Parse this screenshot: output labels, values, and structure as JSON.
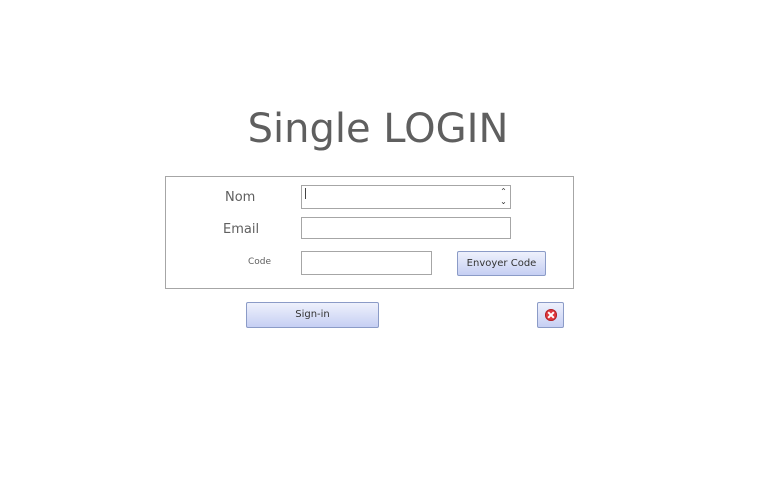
{
  "page": {
    "title": "Single LOGIN"
  },
  "form": {
    "nom": {
      "label": "Nom",
      "value": ""
    },
    "email": {
      "label": "Email",
      "value": ""
    },
    "code": {
      "label": "Code",
      "value": ""
    },
    "send_code_label": "Envoyer Code"
  },
  "actions": {
    "signin_label": "Sign-in",
    "close_icon": "close-circle-icon"
  },
  "colors": {
    "button_top": "#eef1fc",
    "button_bottom": "#c6cff3",
    "button_border": "#8b9bc7",
    "close_red": "#e0393e",
    "text_gray": "#5f5f5f"
  }
}
